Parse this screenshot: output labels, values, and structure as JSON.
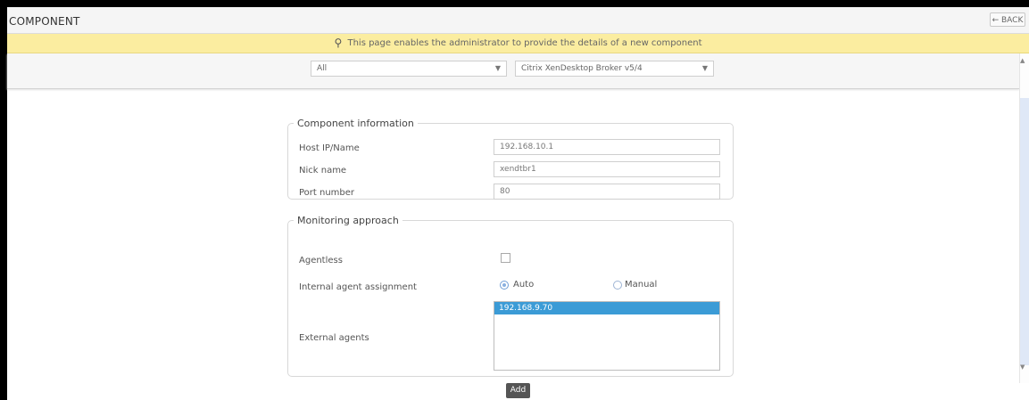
{
  "header": {
    "title": "COMPONENT",
    "back_label": "← BACK"
  },
  "info_message": "This page enables the administrator to provide the details of a new component",
  "filters": {
    "left": {
      "value": "All"
    },
    "right": {
      "value": "Citrix XenDesktop Broker v5/4"
    }
  },
  "component_information": {
    "legend": "Component information",
    "fields": [
      {
        "label": "Host IP/Name",
        "value": "192.168.10.1"
      },
      {
        "label": "Nick name",
        "value": "xendtbr1"
      },
      {
        "label": "Port number",
        "value": "80"
      }
    ]
  },
  "monitoring_approach": {
    "legend": "Monitoring approach",
    "agentless_label": "Agentless",
    "agentless_checked": false,
    "internal_agent_label": "Internal agent assignment",
    "radio_options": [
      {
        "label": "Auto",
        "checked": true
      },
      {
        "label": "Manual",
        "checked": false
      }
    ],
    "external_agents_label": "External agents",
    "external_agents": [
      {
        "value": "192.168.9.70",
        "selected": true
      }
    ]
  },
  "add_button": "Add",
  "colors": {
    "info_bar": "#fbeda0",
    "selection": "#3b9bd6",
    "button": "#555555"
  }
}
